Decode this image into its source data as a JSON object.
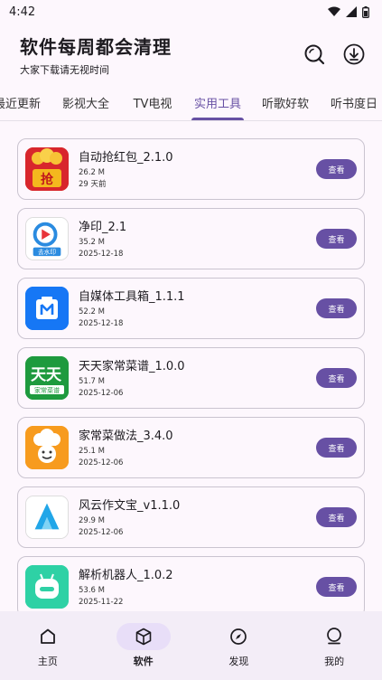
{
  "status_bar": {
    "time": "4:42"
  },
  "header": {
    "title": "软件每周都会清理",
    "subtitle": "大家下载请无视时间"
  },
  "tabs": [
    {
      "label": "最近更新"
    },
    {
      "label": "影视大全"
    },
    {
      "label": "TV电视"
    },
    {
      "label": "实用工具",
      "active": true
    },
    {
      "label": "听歌好软"
    },
    {
      "label": "听书度日"
    }
  ],
  "view_label": "查看",
  "apps": [
    {
      "name": "自动抢红包_2.1.0",
      "size": "26.2 M",
      "date": "29 天前",
      "icon": "red-packet-icon"
    },
    {
      "name": "净印_2.1",
      "size": "35.2 M",
      "date": "2025-12-18",
      "icon": "watermark-remover-icon",
      "icon_text": "去水印"
    },
    {
      "name": "自媒体工具箱_1.1.1",
      "size": "52.2 M",
      "date": "2025-12-18",
      "icon": "toolbox-icon"
    },
    {
      "name": "天天家常菜谱_1.0.0",
      "size": "51.7 M",
      "date": "2025-12-06",
      "icon": "recipe-icon",
      "icon_text": "天天",
      "icon_subtext": "家常菜谱"
    },
    {
      "name": "家常菜做法_3.4.0",
      "size": "25.1 M",
      "date": "2025-12-06",
      "icon": "chef-icon"
    },
    {
      "name": "风云作文宝_v1.1.0",
      "size": "29.9 M",
      "date": "2025-12-06",
      "icon": "writing-app-icon"
    },
    {
      "name": "解析机器人_1.0.2",
      "size": "53.6 M",
      "date": "2025-11-22",
      "icon": "robot-icon"
    }
  ],
  "bottom_nav": [
    {
      "label": "主页",
      "icon": "home-icon"
    },
    {
      "label": "软件",
      "icon": "package-icon",
      "active": true
    },
    {
      "label": "发现",
      "icon": "compass-icon"
    },
    {
      "label": "我的",
      "icon": "profile-icon"
    }
  ],
  "colors": {
    "accent": "#6750a4",
    "background": "#fdf7fd",
    "nav_background": "#f3edf7",
    "nav_active": "#e8def8"
  }
}
